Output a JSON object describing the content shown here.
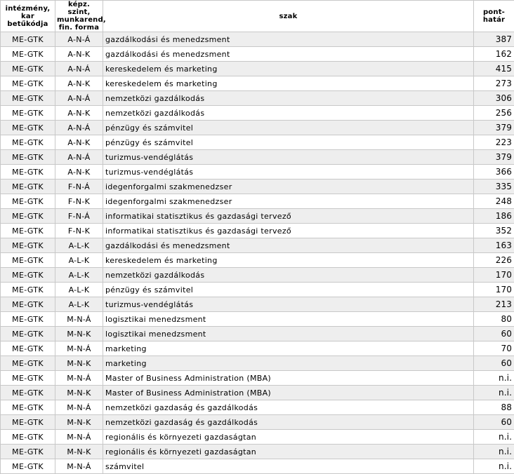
{
  "headers": {
    "institution": [
      "intézmény,",
      "kar betűkódja"
    ],
    "training": [
      "képz. szint,",
      "munkarend,",
      "fin. forma"
    ],
    "major": "szak",
    "score": [
      "pont-",
      "határ"
    ]
  },
  "rows": [
    {
      "institution": "ME-GTK",
      "form": "A-N-Á",
      "major": "gazdálkodási és menedzsment",
      "score": "387"
    },
    {
      "institution": "ME-GTK",
      "form": "A-N-K",
      "major": "gazdálkodási és menedzsment",
      "score": "162"
    },
    {
      "institution": "ME-GTK",
      "form": "A-N-Á",
      "major": "kereskedelem és marketing",
      "score": "415"
    },
    {
      "institution": "ME-GTK",
      "form": "A-N-K",
      "major": "kereskedelem és marketing",
      "score": "273"
    },
    {
      "institution": "ME-GTK",
      "form": "A-N-Á",
      "major": "nemzetközi gazdálkodás",
      "score": "306"
    },
    {
      "institution": "ME-GTK",
      "form": "A-N-K",
      "major": "nemzetközi gazdálkodás",
      "score": "256"
    },
    {
      "institution": "ME-GTK",
      "form": "A-N-Á",
      "major": "pénzügy és számvitel",
      "score": "379"
    },
    {
      "institution": "ME-GTK",
      "form": "A-N-K",
      "major": "pénzügy és számvitel",
      "score": "223"
    },
    {
      "institution": "ME-GTK",
      "form": "A-N-Á",
      "major": "turizmus-vendéglátás",
      "score": "379"
    },
    {
      "institution": "ME-GTK",
      "form": "A-N-K",
      "major": "turizmus-vendéglátás",
      "score": "366"
    },
    {
      "institution": "ME-GTK",
      "form": "F-N-Á",
      "major": "idegenforgalmi szakmenedzser",
      "score": "335"
    },
    {
      "institution": "ME-GTK",
      "form": "F-N-K",
      "major": "idegenforgalmi szakmenedzser",
      "score": "248"
    },
    {
      "institution": "ME-GTK",
      "form": "F-N-Á",
      "major": "informatikai statisztikus és gazdasági tervező",
      "score": "186"
    },
    {
      "institution": "ME-GTK",
      "form": "F-N-K",
      "major": "informatikai statisztikus és gazdasági tervező",
      "score": "352"
    },
    {
      "institution": "ME-GTK",
      "form": "A-L-K",
      "major": "gazdálkodási és menedzsment",
      "score": "163"
    },
    {
      "institution": "ME-GTK",
      "form": "A-L-K",
      "major": "kereskedelem és marketing",
      "score": "226"
    },
    {
      "institution": "ME-GTK",
      "form": "A-L-K",
      "major": "nemzetközi gazdálkodás",
      "score": "170"
    },
    {
      "institution": "ME-GTK",
      "form": "A-L-K",
      "major": "pénzügy és számvitel",
      "score": "170"
    },
    {
      "institution": "ME-GTK",
      "form": "A-L-K",
      "major": "turizmus-vendéglátás",
      "score": "213"
    },
    {
      "institution": "ME-GTK",
      "form": "M-N-Á",
      "major": "logisztikai menedzsment",
      "score": "80"
    },
    {
      "institution": "ME-GTK",
      "form": "M-N-K",
      "major": "logisztikai menedzsment",
      "score": "60"
    },
    {
      "institution": "ME-GTK",
      "form": "M-N-Á",
      "major": "marketing",
      "score": "70"
    },
    {
      "institution": "ME-GTK",
      "form": "M-N-K",
      "major": "marketing",
      "score": "60"
    },
    {
      "institution": "ME-GTK",
      "form": "M-N-Á",
      "major": "Master of Business Administration (MBA)",
      "score": "n.i."
    },
    {
      "institution": "ME-GTK",
      "form": "M-N-K",
      "major": "Master of Business Administration (MBA)",
      "score": "n.i."
    },
    {
      "institution": "ME-GTK",
      "form": "M-N-Á",
      "major": "nemzetközi gazdaság és gazdálkodás",
      "score": "88"
    },
    {
      "institution": "ME-GTK",
      "form": "M-N-K",
      "major": "nemzetközi gazdaság és gazdálkodás",
      "score": "60"
    },
    {
      "institution": "ME-GTK",
      "form": "M-N-Á",
      "major": "regionális és környezeti gazdaságtan",
      "score": "n.i."
    },
    {
      "institution": "ME-GTK",
      "form": "M-N-K",
      "major": "regionális és környezeti gazdaságtan",
      "score": "n.i."
    },
    {
      "institution": "ME-GTK",
      "form": "M-N-Á",
      "major": "számvitel",
      "score": "n.i."
    }
  ]
}
